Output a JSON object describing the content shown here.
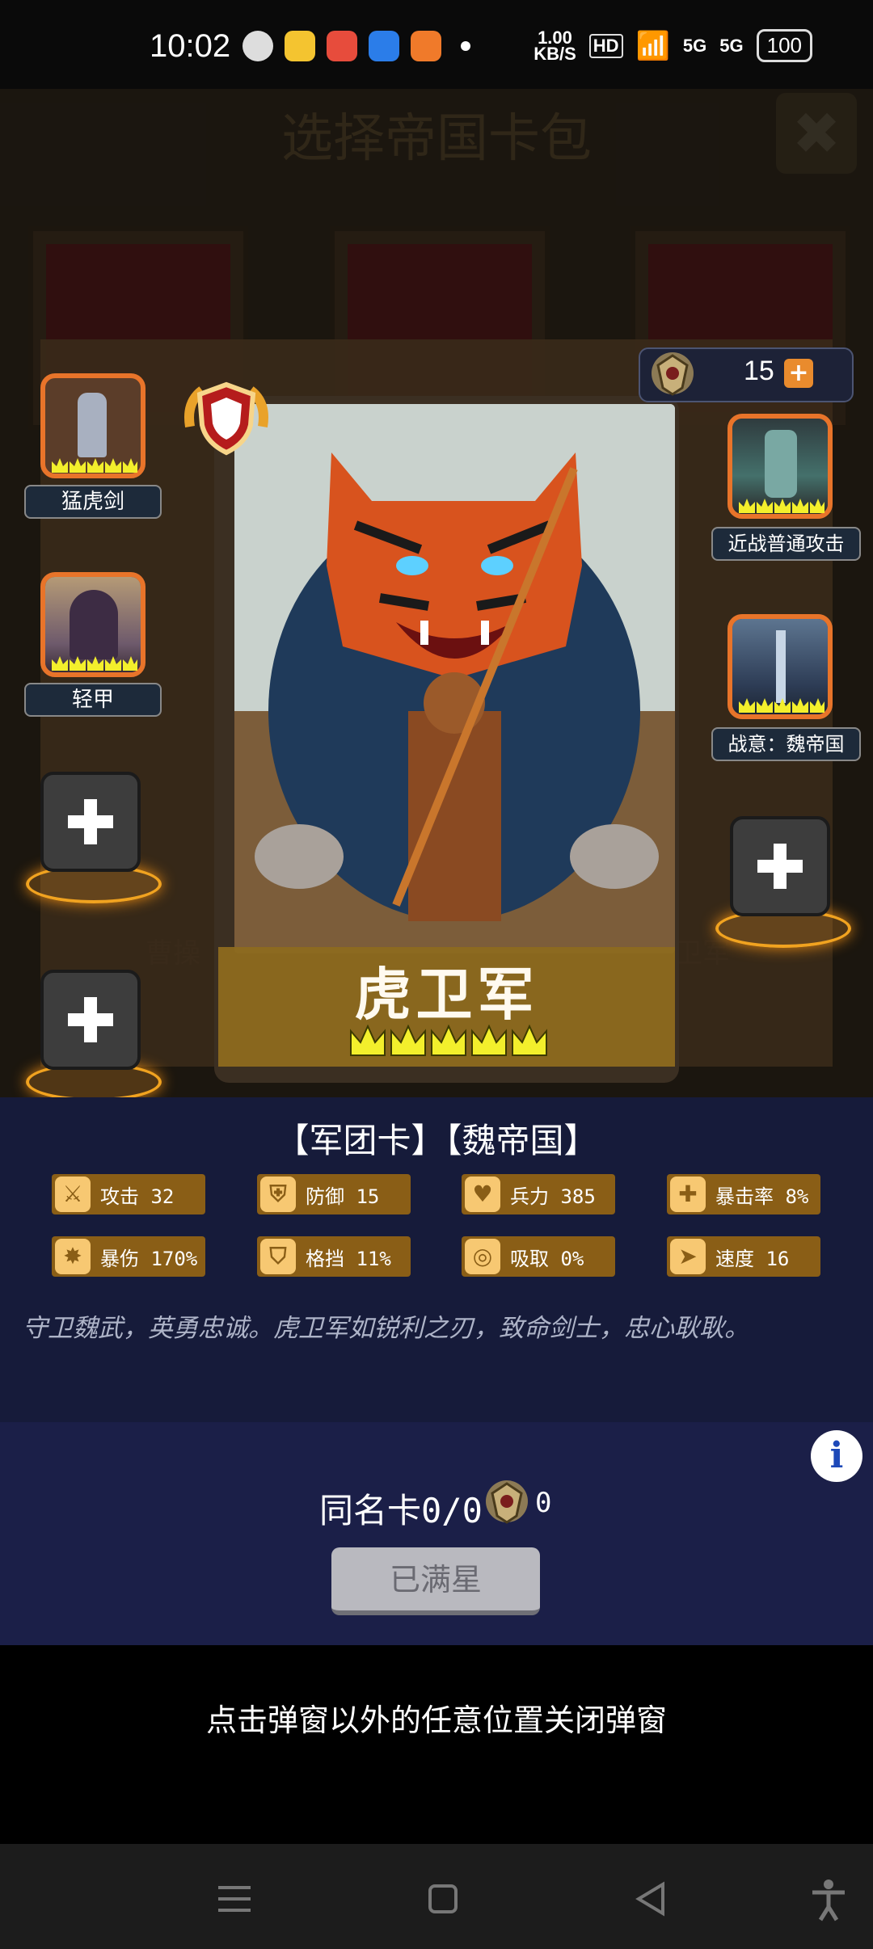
{
  "status_bar": {
    "time": "10:02",
    "net_speed": "1.00\nKB/S",
    "hd_badge": "HD",
    "sim1": "5G",
    "sim2": "5G",
    "battery": "100"
  },
  "background": {
    "title": "选择帝国卡包",
    "close_label": "✖",
    "left_card_label": "曹操",
    "right_card_label": "卫军"
  },
  "card": {
    "name": "虎卫军",
    "stars": 5,
    "type_line": "【军团卡】【魏帝国】",
    "description": "守卫魏武，英勇忠诚。虎卫军如锐利之刃，致命剑士，忠心耿耿。"
  },
  "currency": {
    "value": "15",
    "plus_label": "+"
  },
  "left_slots": [
    {
      "label": "猛虎剑"
    },
    {
      "label": "轻甲"
    }
  ],
  "right_slots": [
    {
      "label": "近战普通攻击"
    },
    {
      "label": "战意：魏帝国"
    }
  ],
  "stats": [
    {
      "icon": "sword-icon",
      "label": "攻击 32"
    },
    {
      "icon": "shield-icon",
      "label": "防御 15"
    },
    {
      "icon": "heart-icon",
      "label": "兵力 385"
    },
    {
      "icon": "crit-icon",
      "label": "暴击率 8%"
    },
    {
      "icon": "crit-damage-icon",
      "label": "暴伤 170%"
    },
    {
      "icon": "block-icon",
      "label": "格挡 11%"
    },
    {
      "icon": "lifesteal-icon",
      "label": "吸取 0%"
    },
    {
      "icon": "speed-icon",
      "label": "速度 16"
    }
  ],
  "duplicate": {
    "label": "同名卡0/0",
    "count": "0"
  },
  "maxed_button": "已满星",
  "close_hint": "点击弹窗以外的任意位置关闭弹窗",
  "colors": {
    "accent_orange": "#e8742a",
    "gold": "#8a5e16",
    "panel": "#161b3a"
  }
}
